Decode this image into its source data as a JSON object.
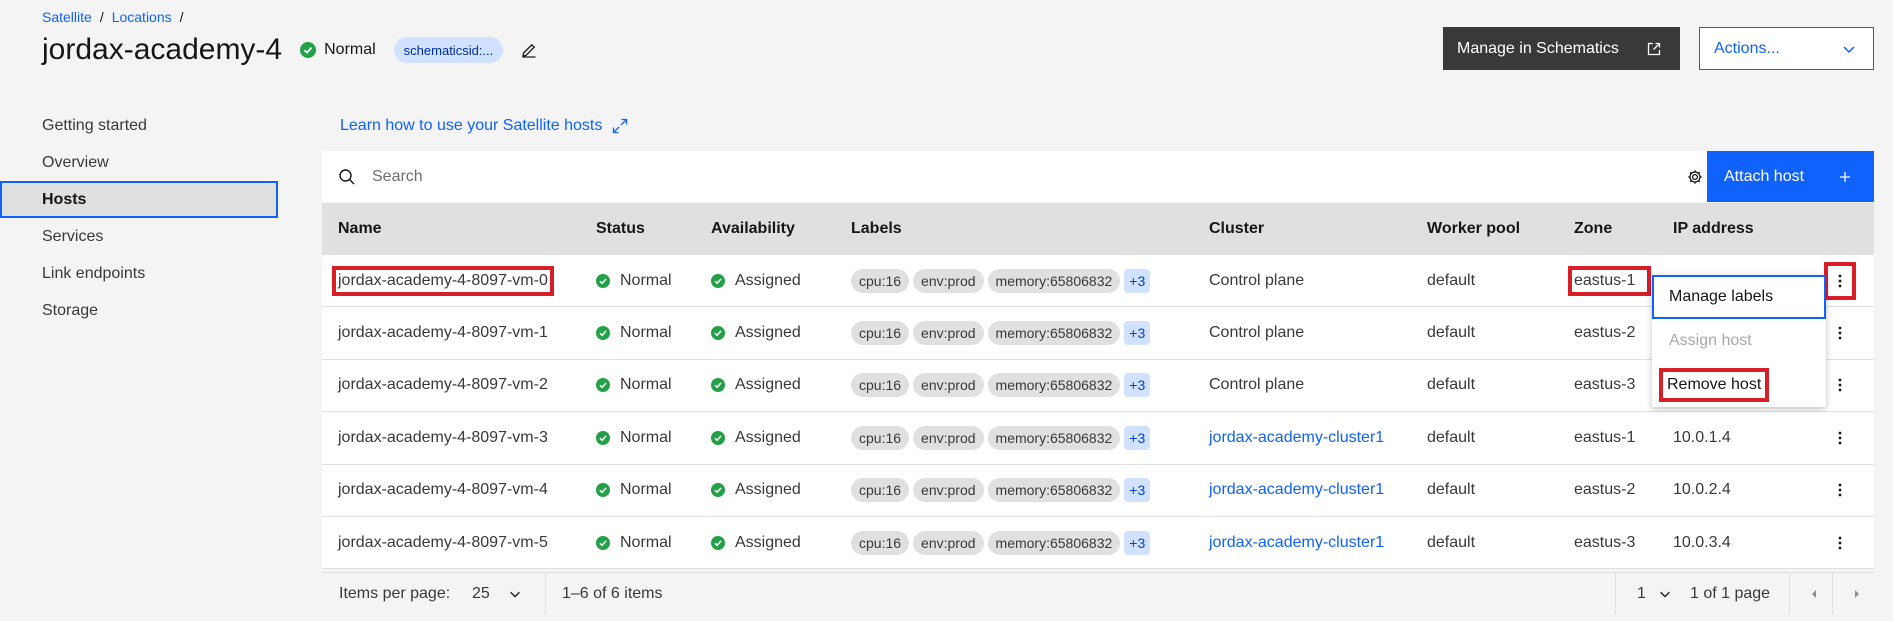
{
  "breadcrumb": {
    "items": [
      "Satellite",
      "Locations"
    ],
    "separator": "/"
  },
  "header": {
    "title": "jordax-academy-4",
    "status": "Normal",
    "tag": "schematicsid:...",
    "manage_button": "Manage in Schematics",
    "actions_button": "Actions..."
  },
  "sidebar": {
    "items": [
      {
        "label": "Getting started"
      },
      {
        "label": "Overview"
      },
      {
        "label": "Hosts",
        "active": true
      },
      {
        "label": "Services"
      },
      {
        "label": "Link endpoints"
      },
      {
        "label": "Storage"
      }
    ]
  },
  "main": {
    "learn_link": "Learn how to use your Satellite hosts",
    "search_placeholder": "Search",
    "attach_button": "Attach host",
    "columns": [
      "Name",
      "Status",
      "Availability",
      "Labels",
      "Cluster",
      "Worker pool",
      "Zone",
      "IP address"
    ],
    "rows": [
      {
        "name": "jordax-academy-4-8097-vm-0",
        "status": "Normal",
        "availability": "Assigned",
        "labels": [
          "cpu:16",
          "env:prod",
          "memory:65806832"
        ],
        "more": "+3",
        "cluster": "Control plane",
        "cluster_link": false,
        "pool": "default",
        "zone": "eastus-1",
        "ip": ""
      },
      {
        "name": "jordax-academy-4-8097-vm-1",
        "status": "Normal",
        "availability": "Assigned",
        "labels": [
          "cpu:16",
          "env:prod",
          "memory:65806832"
        ],
        "more": "+3",
        "cluster": "Control plane",
        "cluster_link": false,
        "pool": "default",
        "zone": "eastus-2",
        "ip": ""
      },
      {
        "name": "jordax-academy-4-8097-vm-2",
        "status": "Normal",
        "availability": "Assigned",
        "labels": [
          "cpu:16",
          "env:prod",
          "memory:65806832"
        ],
        "more": "+3",
        "cluster": "Control plane",
        "cluster_link": false,
        "pool": "default",
        "zone": "eastus-3",
        "ip": ""
      },
      {
        "name": "jordax-academy-4-8097-vm-3",
        "status": "Normal",
        "availability": "Assigned",
        "labels": [
          "cpu:16",
          "env:prod",
          "memory:65806832"
        ],
        "more": "+3",
        "cluster": "jordax-academy-cluster1",
        "cluster_link": true,
        "pool": "default",
        "zone": "eastus-1",
        "ip": "10.0.1.4"
      },
      {
        "name": "jordax-academy-4-8097-vm-4",
        "status": "Normal",
        "availability": "Assigned",
        "labels": [
          "cpu:16",
          "env:prod",
          "memory:65806832"
        ],
        "more": "+3",
        "cluster": "jordax-academy-cluster1",
        "cluster_link": true,
        "pool": "default",
        "zone": "eastus-2",
        "ip": "10.0.2.4"
      },
      {
        "name": "jordax-academy-4-8097-vm-5",
        "status": "Normal",
        "availability": "Assigned",
        "labels": [
          "cpu:16",
          "env:prod",
          "memory:65806832"
        ],
        "more": "+3",
        "cluster": "jordax-academy-cluster1",
        "cluster_link": true,
        "pool": "default",
        "zone": "eastus-3",
        "ip": "10.0.3.4"
      }
    ],
    "overflow_menu": {
      "items": [
        {
          "label": "Manage labels",
          "state": "focused"
        },
        {
          "label": "Assign host",
          "state": "disabled"
        },
        {
          "label": "Remove host",
          "state": "highlighted"
        }
      ]
    },
    "pagination": {
      "items_per_page_label": "Items per page:",
      "items_per_page": "25",
      "range_text": "1–6 of 6 items",
      "page": "1",
      "page_of": "1 of 1 page"
    }
  },
  "colors": {
    "accent": "#0f62fe",
    "success": "#24a148",
    "highlight": "#da1e28",
    "dark_button": "#393939"
  }
}
